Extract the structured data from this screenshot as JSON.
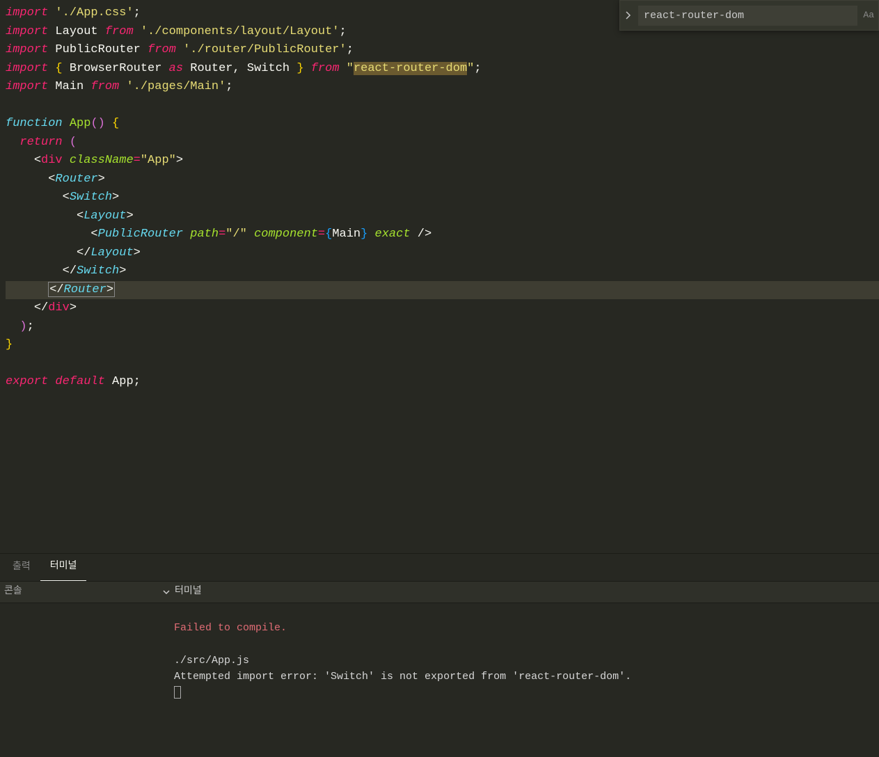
{
  "find": {
    "value": "react-router-dom",
    "opt_case": "Aa"
  },
  "code": {
    "l1": {
      "import": "import",
      "path": "'./App.css'",
      "semi": ";"
    },
    "l2": {
      "import": "import",
      "ident": "Layout",
      "from": "from",
      "path": "'./components/layout/Layout'",
      "semi": ";"
    },
    "l3": {
      "import": "import",
      "ident": "PublicRouter",
      "from": "from",
      "path": "'./router/PublicRouter'",
      "semi": ";"
    },
    "l4": {
      "import": "import",
      "browser": "BrowserRouter",
      "as": "as",
      "router": "Router",
      "comma": ", ",
      "switch": "Switch",
      "from": "from",
      "q1": "\"",
      "hl": "react-router-dom",
      "q2": "\"",
      "semi": ";"
    },
    "l5": {
      "import": "import",
      "ident": "Main",
      "from": "from",
      "path": "'./pages/Main'",
      "semi": ";"
    },
    "l7": {
      "fn": "function",
      "name": "App",
      "paren": "() ",
      "brace": "{"
    },
    "l8": {
      "ret": "return",
      "paren": " ("
    },
    "l9": {
      "open": "<",
      "tag": "div",
      "sp": " ",
      "attr": "className",
      "eq": "=",
      "val": "\"App\"",
      "close": ">"
    },
    "l10": {
      "open": "<",
      "comp": "Router",
      "close": ">"
    },
    "l11": {
      "open": "<",
      "comp": "Switch",
      "close": ">"
    },
    "l12": {
      "open": "<",
      "comp": "Layout",
      "close": ">"
    },
    "l13": {
      "open": "<",
      "comp": "PublicRouter",
      "sp": " ",
      "a1": "path",
      "eq": "=",
      "v1": "\"/\"",
      "sp2": " ",
      "a2": "component",
      "eq2": "=",
      "br1": "{",
      "main": "Main",
      "br2": "}",
      "sp3": " ",
      "a3": "exact",
      "sp4": " ",
      "slash": "/>"
    },
    "l14": {
      "open": "</",
      "comp": "Layout",
      "close": ">"
    },
    "l15": {
      "open": "</",
      "comp": "Switch",
      "close": ">"
    },
    "l16": {
      "open": "</",
      "comp": "Router",
      "close": ">"
    },
    "l17": {
      "open": "</",
      "tag": "div",
      "close": ">"
    },
    "l18": {
      "paren": ")",
      "semi": ";"
    },
    "l19": {
      "brace": "}"
    },
    "l21": {
      "exp": "export",
      "def": "default",
      "name": "App",
      "semi": ";"
    }
  },
  "panel": {
    "tab_output": "출력",
    "tab_terminal": "터미널",
    "sub_left": "콘솔",
    "sub_right": "터미널"
  },
  "terminal": {
    "error": "Failed to compile.",
    "file": "./src/App.js",
    "msg": "Attempted import error: 'Switch' is not exported from 'react-router-dom'."
  }
}
